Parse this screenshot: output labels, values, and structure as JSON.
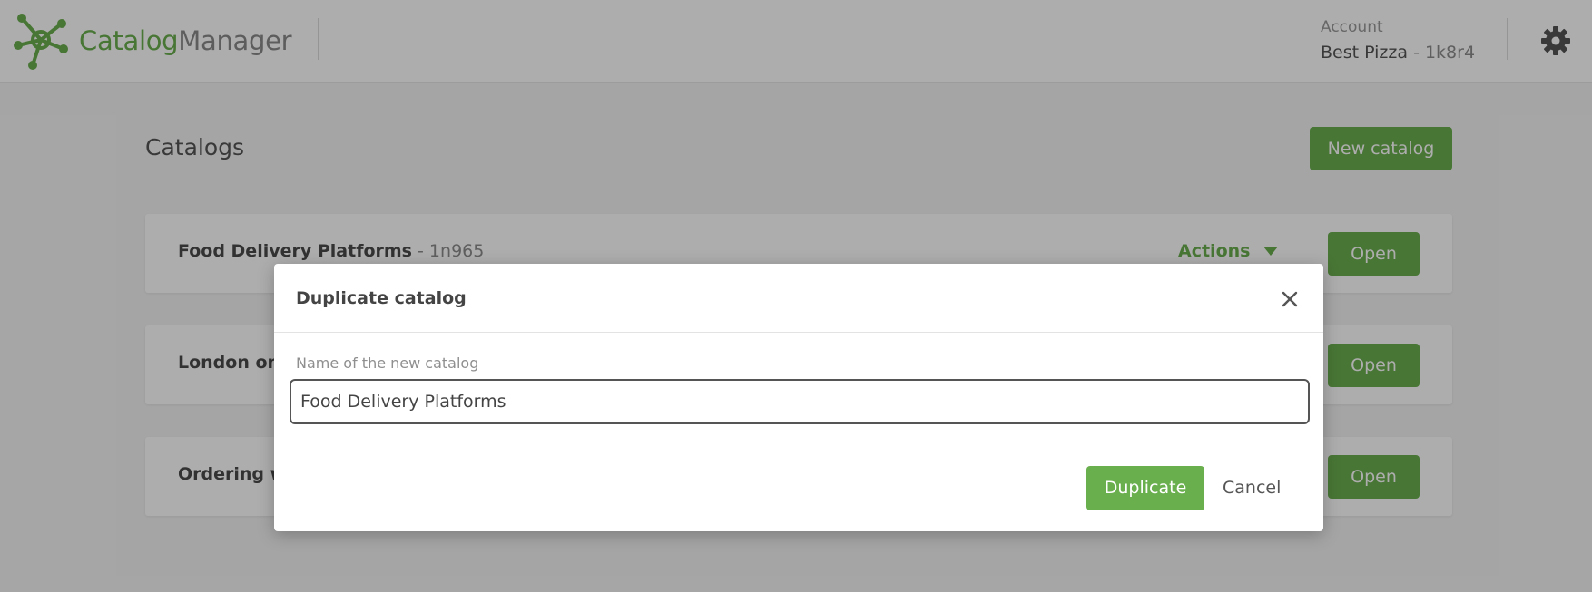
{
  "header": {
    "brand_part1": "Catalog",
    "brand_part2": "Manager",
    "account_label": "Account",
    "account_name": "Best Pizza",
    "account_code": " - 1k8r4",
    "logo_icon": "network-logo-icon",
    "settings_icon": "gear-icon"
  },
  "page": {
    "title": "Catalogs",
    "new_catalog_label": "New catalog"
  },
  "catalogs": [
    {
      "name": "Food Delivery Platforms",
      "code": " - 1n965",
      "actions_label": "Actions",
      "open_label": "Open"
    },
    {
      "name": "London onl",
      "code": "",
      "open_label": "Open"
    },
    {
      "name": "Ordering w",
      "code": "",
      "open_label": "Open"
    }
  ],
  "modal": {
    "title": "Duplicate catalog",
    "field_label": "Name of the new catalog",
    "field_value": "Food Delivery Platforms",
    "duplicate_label": "Duplicate",
    "cancel_label": "Cancel",
    "close_icon": "close-icon"
  },
  "colors": {
    "brand_green": "#6aaf4e",
    "text_dark": "#555555",
    "overlay": "rgba(0,0,0,0.32)"
  }
}
